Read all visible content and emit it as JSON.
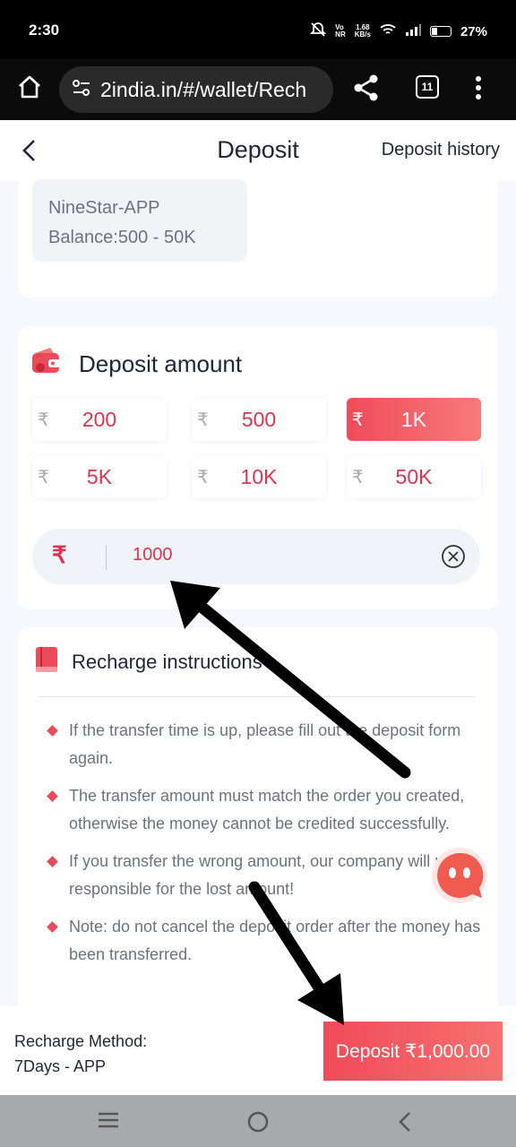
{
  "status_bar": {
    "time": "2:30",
    "net_speed_top": "1.68",
    "net_speed_bottom": "KB/s",
    "battery": "27%",
    "battery_level": 0.27
  },
  "browser": {
    "url": "2india.in/#/wallet/Rech",
    "tab_count": "11"
  },
  "header": {
    "title": "Deposit",
    "history_label": "Deposit history"
  },
  "channel": {
    "name": "NineStar-APP",
    "balance": "Balance:500 - 50K"
  },
  "deposit_amount": {
    "title": "Deposit amount",
    "currency_symbol": "₹",
    "options": [
      "200",
      "500",
      "1K",
      "5K",
      "10K",
      "50K"
    ],
    "selected_index": 2,
    "input_value": "1000"
  },
  "instructions": {
    "title": "Recharge instructions",
    "items": [
      "If the transfer time is up, please fill out the deposit form again.",
      "The transfer amount must match the order you created, otherwise the money cannot be credited successfully.",
      "If you transfer the wrong amount, our company will not be responsible for the lost amount!",
      "Note: do not cancel the deposit order after the money has been transferred."
    ]
  },
  "footer": {
    "method_label": "Recharge Method:",
    "method_value": "7Days - APP",
    "deposit_button": "Deposit ₹1,000.00"
  },
  "colors": {
    "accent": "#f04b5a",
    "text_primary": "#1e2637",
    "text_secondary": "#6e7180",
    "background": "#f7f8ff"
  }
}
